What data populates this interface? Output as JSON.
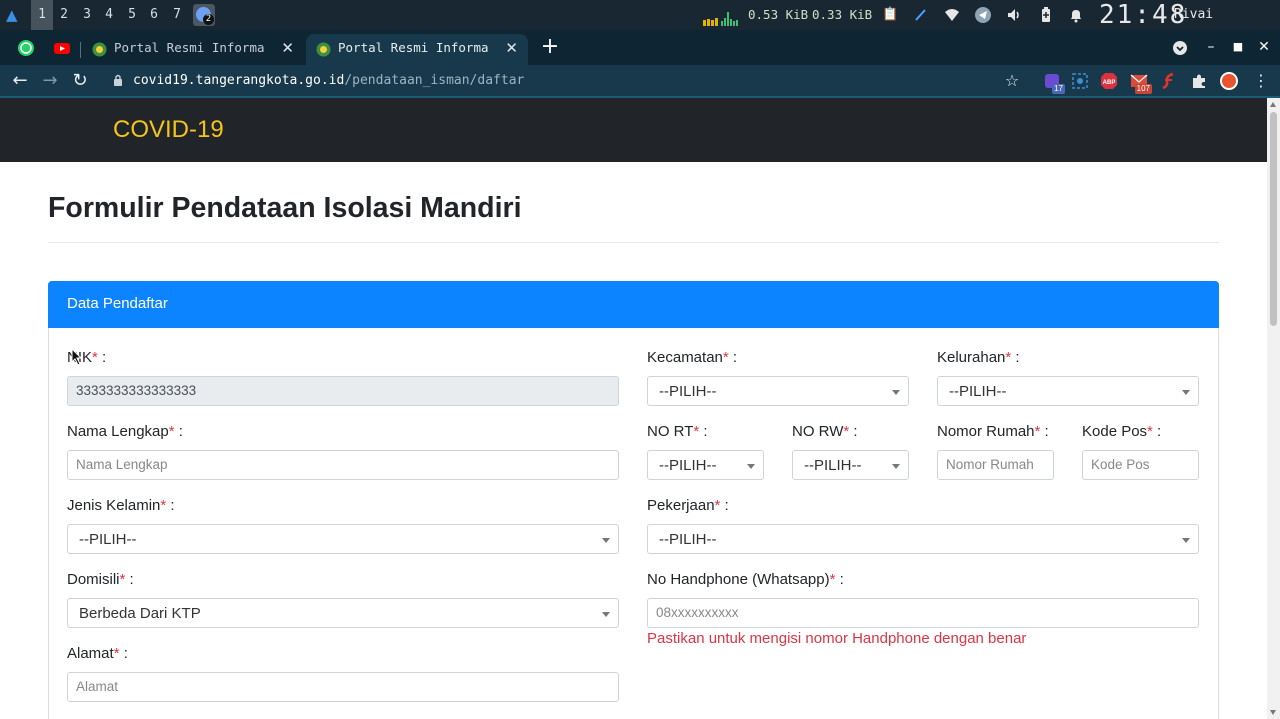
{
  "system_bar": {
    "workspaces": [
      "1",
      "2",
      "3",
      "4",
      "5",
      "6",
      "7"
    ],
    "active_workspace": "1",
    "workspace_badge_count": "2",
    "net_down": "0.53 KiB",
    "net_up": "0.33 KiB",
    "clock": "21:48",
    "user": "Rivai Sungkowo",
    "icons": [
      "clipboard-icon",
      "pen-icon",
      "wifi-icon",
      "telegram-icon",
      "volume-icon",
      "battery-icon",
      "bell-icon"
    ]
  },
  "browser": {
    "tabs": [
      {
        "title": "Portal Resmi Informasi",
        "active": false
      },
      {
        "title": "Portal Resmi Informasi",
        "active": true
      }
    ],
    "pinned": [
      "whatsapp-icon",
      "youtube-icon"
    ],
    "new_tab": "+",
    "address": {
      "host": "covid19.tangerangkota.go.id",
      "path": "/pendataan_isman/daftar"
    },
    "extensions": [
      {
        "name": "extension-badge-icon",
        "badge": "17"
      },
      {
        "name": "screenshot-icon",
        "badge": ""
      },
      {
        "name": "adblock-icon",
        "badge": ""
      },
      {
        "name": "mail-icon",
        "badge": "107"
      },
      {
        "name": "flash-icon",
        "badge": ""
      },
      {
        "name": "puzzle-icon",
        "badge": ""
      }
    ]
  },
  "site": {
    "brand": "COVID-19",
    "page_title": "Formulir Pendataan Isolasi Mandiri",
    "card_title": "Data Pendaftar",
    "required_mark": "*",
    "fields": {
      "nik": {
        "label": "NIK",
        "value": "3333333333333333"
      },
      "nama": {
        "label": "Nama Lengkap",
        "placeholder": "Nama Lengkap"
      },
      "jenis_kelamin": {
        "label": "Jenis Kelamin",
        "value": "--PILIH--"
      },
      "domisili": {
        "label": "Domisili",
        "value": "Berbeda Dari KTP"
      },
      "alamat": {
        "label": "Alamat",
        "placeholder": "Alamat"
      },
      "kecamatan": {
        "label": "Kecamatan",
        "value": "--PILIH--"
      },
      "kelurahan": {
        "label": "Kelurahan",
        "value": "--PILIH--"
      },
      "no_rt": {
        "label": "NO RT",
        "value": "--PILIH--"
      },
      "no_rw": {
        "label": "NO RW",
        "value": "--PILIH--"
      },
      "nomor_rumah": {
        "label": "Nomor Rumah",
        "placeholder": "Nomor Rumah"
      },
      "kode_pos": {
        "label": "Kode Pos",
        "placeholder": "Kode Pos"
      },
      "pekerjaan": {
        "label": "Pekerjaan",
        "value": "--PILIH--"
      },
      "no_hp": {
        "label": "No Handphone (Whatsapp)",
        "placeholder": "08xxxxxxxxxx",
        "help": "Pastikan untuk mengisi nomor Handphone dengan benar"
      }
    }
  }
}
